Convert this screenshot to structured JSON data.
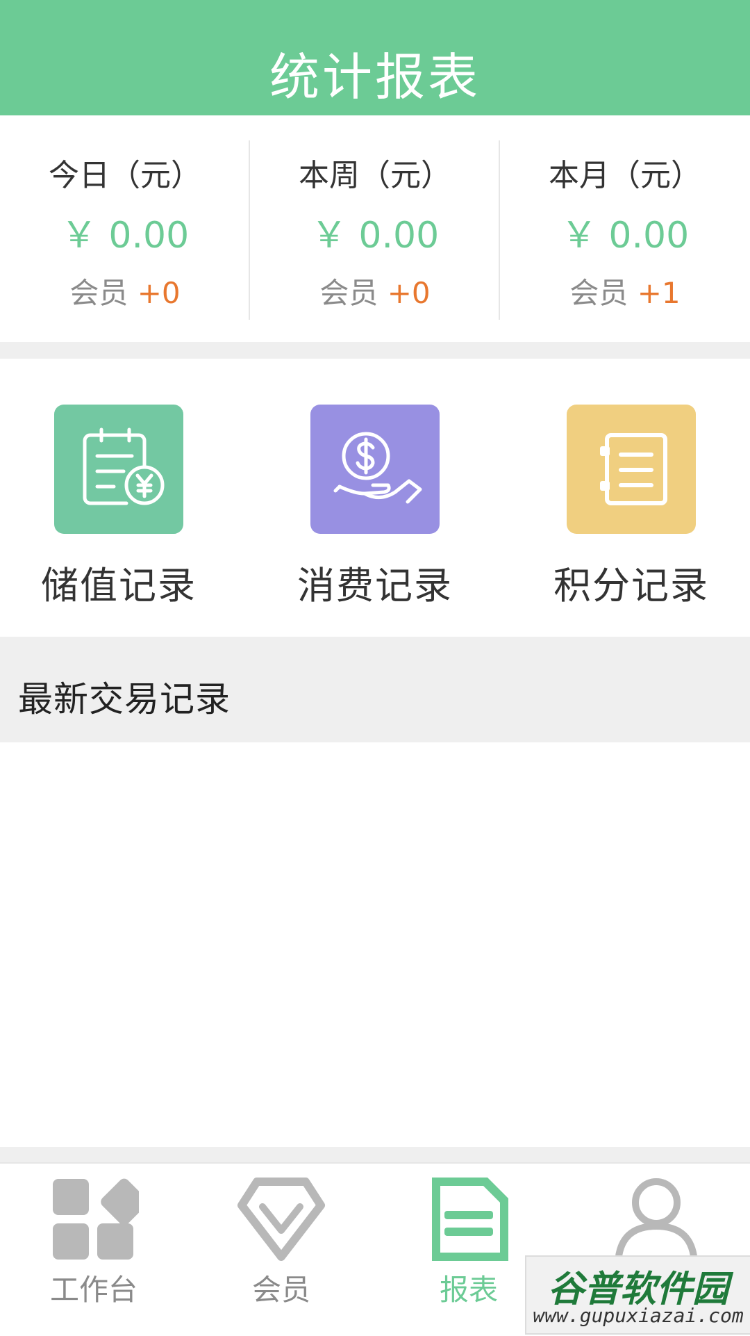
{
  "header": {
    "title": "统计报表"
  },
  "stats": [
    {
      "label": "今日（元）",
      "amount": "￥ 0.00",
      "members_label": "会员",
      "members_delta": "+0"
    },
    {
      "label": "本周（元）",
      "amount": "￥ 0.00",
      "members_label": "会员",
      "members_delta": "+0"
    },
    {
      "label": "本月（元）",
      "amount": "￥ 0.00",
      "members_label": "会员",
      "members_delta": "+1"
    }
  ],
  "shortcuts": [
    {
      "label": "储值记录",
      "icon": "stored-value-icon",
      "color": "#73c8a2"
    },
    {
      "label": "消费记录",
      "icon": "payment-hand-icon",
      "color": "#9890e2"
    },
    {
      "label": "积分记录",
      "icon": "notebook-icon",
      "color": "#f0cf80"
    }
  ],
  "section": {
    "title": "最新交易记录"
  },
  "tabbar": {
    "items": [
      {
        "label": "工作台",
        "icon": "dashboard-icon",
        "active": false
      },
      {
        "label": "会员",
        "icon": "diamond-icon",
        "active": false
      },
      {
        "label": "报表",
        "icon": "report-icon",
        "active": true
      },
      {
        "label": "",
        "icon": "user-icon",
        "active": false
      }
    ]
  },
  "colors": {
    "accent": "#6ccb95",
    "orange": "#e8772e",
    "gray": "#8a8a8a"
  },
  "watermark": {
    "line1": "谷普软件园",
    "line2": "www.gupuxiazai.com"
  }
}
